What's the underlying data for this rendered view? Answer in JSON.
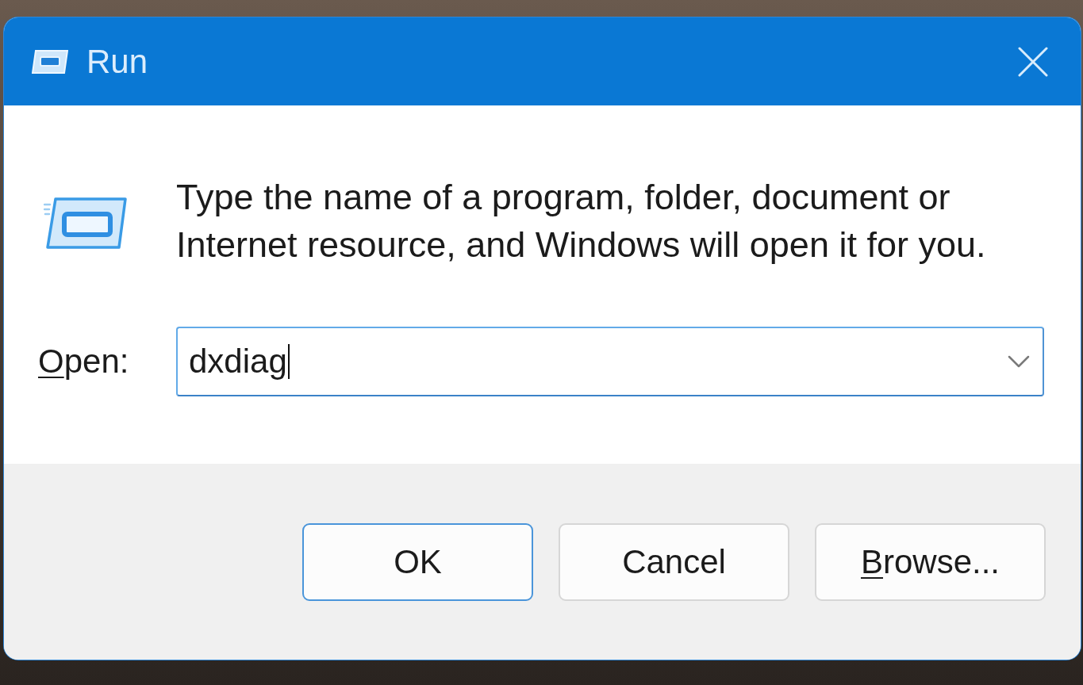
{
  "window": {
    "title": "Run"
  },
  "description": "Type the name of a program, folder, document or Internet resource, and Windows will open it for you.",
  "open_field": {
    "label": "Open:",
    "label_access_key": true,
    "value": "dxdiag",
    "focused": true
  },
  "buttons": [
    {
      "label": "OK",
      "default": true,
      "access_key": false
    },
    {
      "label": "Cancel",
      "default": false,
      "access_key": false
    },
    {
      "label": "Browse...",
      "default": false,
      "access_key": true
    }
  ]
}
